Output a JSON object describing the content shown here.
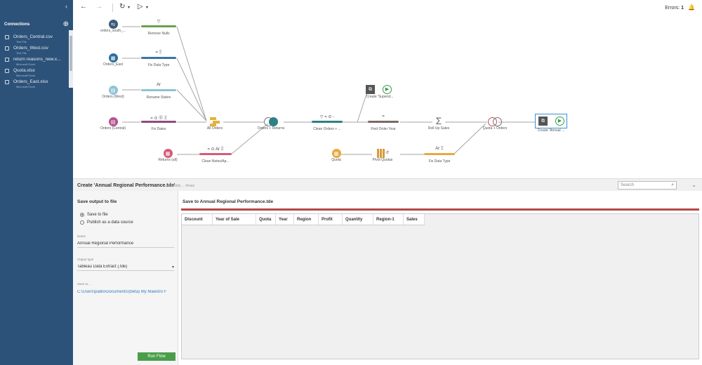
{
  "sidebar": {
    "collapse_icon": "chevron-left-icon",
    "connections_title": "Connections",
    "add_icon": "plus-icon",
    "items": [
      {
        "name": "Orders_Central.csv",
        "type": "Text File",
        "icon": "text-file-icon"
      },
      {
        "name": "Orders_West.csv",
        "type": "Text File",
        "icon": "text-file-icon"
      },
      {
        "name": "return reasons_new.x...",
        "type": "Microsoft Excel",
        "icon": "excel-icon"
      },
      {
        "name": "Quota.xlsx",
        "type": "Microsoft Excel",
        "icon": "excel-icon"
      },
      {
        "name": "Orders_East.xlsx",
        "type": "Microsoft Excel",
        "icon": "excel-icon"
      }
    ]
  },
  "toolbar": {
    "errors_label": "Errors:",
    "errors_count": "1"
  },
  "flow": {
    "nodes": {
      "orders_south": "orders_south_...",
      "remove_nulls": "Remove Nulls",
      "orders_east": "Orders_East",
      "fix_data_type_1": "Fix Data Type",
      "orders_west": "Orders (West)",
      "rename_states": "Rename States",
      "orders_central": "Orders (Central)",
      "fix_dates": "Fix Dates",
      "all_orders": "All Orders",
      "orders_returns": "Orders + Returns",
      "clean_orders": "Clean Orders + ...",
      "find_order_year": "Find Order Year",
      "roll_up_sales": "Roll Up Sales",
      "quota_orders": "Quota + Orders",
      "create_annual": "Create 'Annual ...",
      "create_superstore": "Create 'Superst...",
      "returns_all": "Returns (all)",
      "clean_notes": "Clean Notes/Ap...",
      "quota": "Quota",
      "pivot_quotas": "Pivot Quotas",
      "fix_data_type_2": "Fix Data Type"
    },
    "icons": {
      "remove_nulls": "▽",
      "fix_data_type_1": "= Ξ",
      "rename_states": "Ar",
      "fix_dates": "= ⊙ Ⓖ Ξ",
      "clean_orders": "▽ = ⊙ -",
      "find_order_year": "=",
      "clean_notes": "= ⊙ Ar Ξ",
      "fix_data_type_2": "Ar Ξ",
      "roll_up_sales": "Σ"
    }
  },
  "pane": {
    "title": "Create 'Annual Regional Performance.tde'",
    "subtitle": "9 Fields ... Rows",
    "search_placeholder": "Search"
  },
  "settings": {
    "heading": "Save output to file",
    "radio_save": "Save to file",
    "radio_publish": "Publish as a data source",
    "name_label": "Name",
    "name_value": "Annual Regional Performance",
    "output_type_label": "Output type",
    "output_type_value": "Tableau Data Extract (.tde)",
    "save_to_label": "Save to...",
    "save_to_value": "C:\\Users\\pablo\\Documents\\(beta) My Maestro F",
    "run_button": "Run Flow"
  },
  "preview": {
    "title": "Save to Annual Regional Performance.tde",
    "columns": [
      "Discount",
      "Year of Sale",
      "Quota",
      "Year",
      "Region",
      "Profit",
      "Quantity",
      "Region-1",
      "Sales"
    ]
  }
}
